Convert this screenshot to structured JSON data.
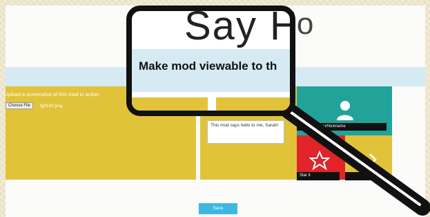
{
  "background_title": "Say Hello",
  "magnifier": {
    "title": "Say Hel",
    "heading": "Make mod viewable to th"
  },
  "upload": {
    "label": "Upload a screenshot of this mod in action",
    "choose_button": "Choose File",
    "file_name": "fg0142.png"
  },
  "message": {
    "value": "This mod says hello to me, Sarah!"
  },
  "tiles": {
    "nickname_label": "by YourNickname",
    "star_label": "Star it"
  },
  "save_button": "Save",
  "colors": {
    "yellow": "#e1c33a",
    "teal": "#21a39a",
    "red": "#e0242a",
    "blue_band": "#d6eaf3",
    "save_blue": "#3db7e3"
  },
  "icons": [
    "person-icon",
    "star-icon",
    "chevron-icon",
    "magnifier-icon"
  ]
}
